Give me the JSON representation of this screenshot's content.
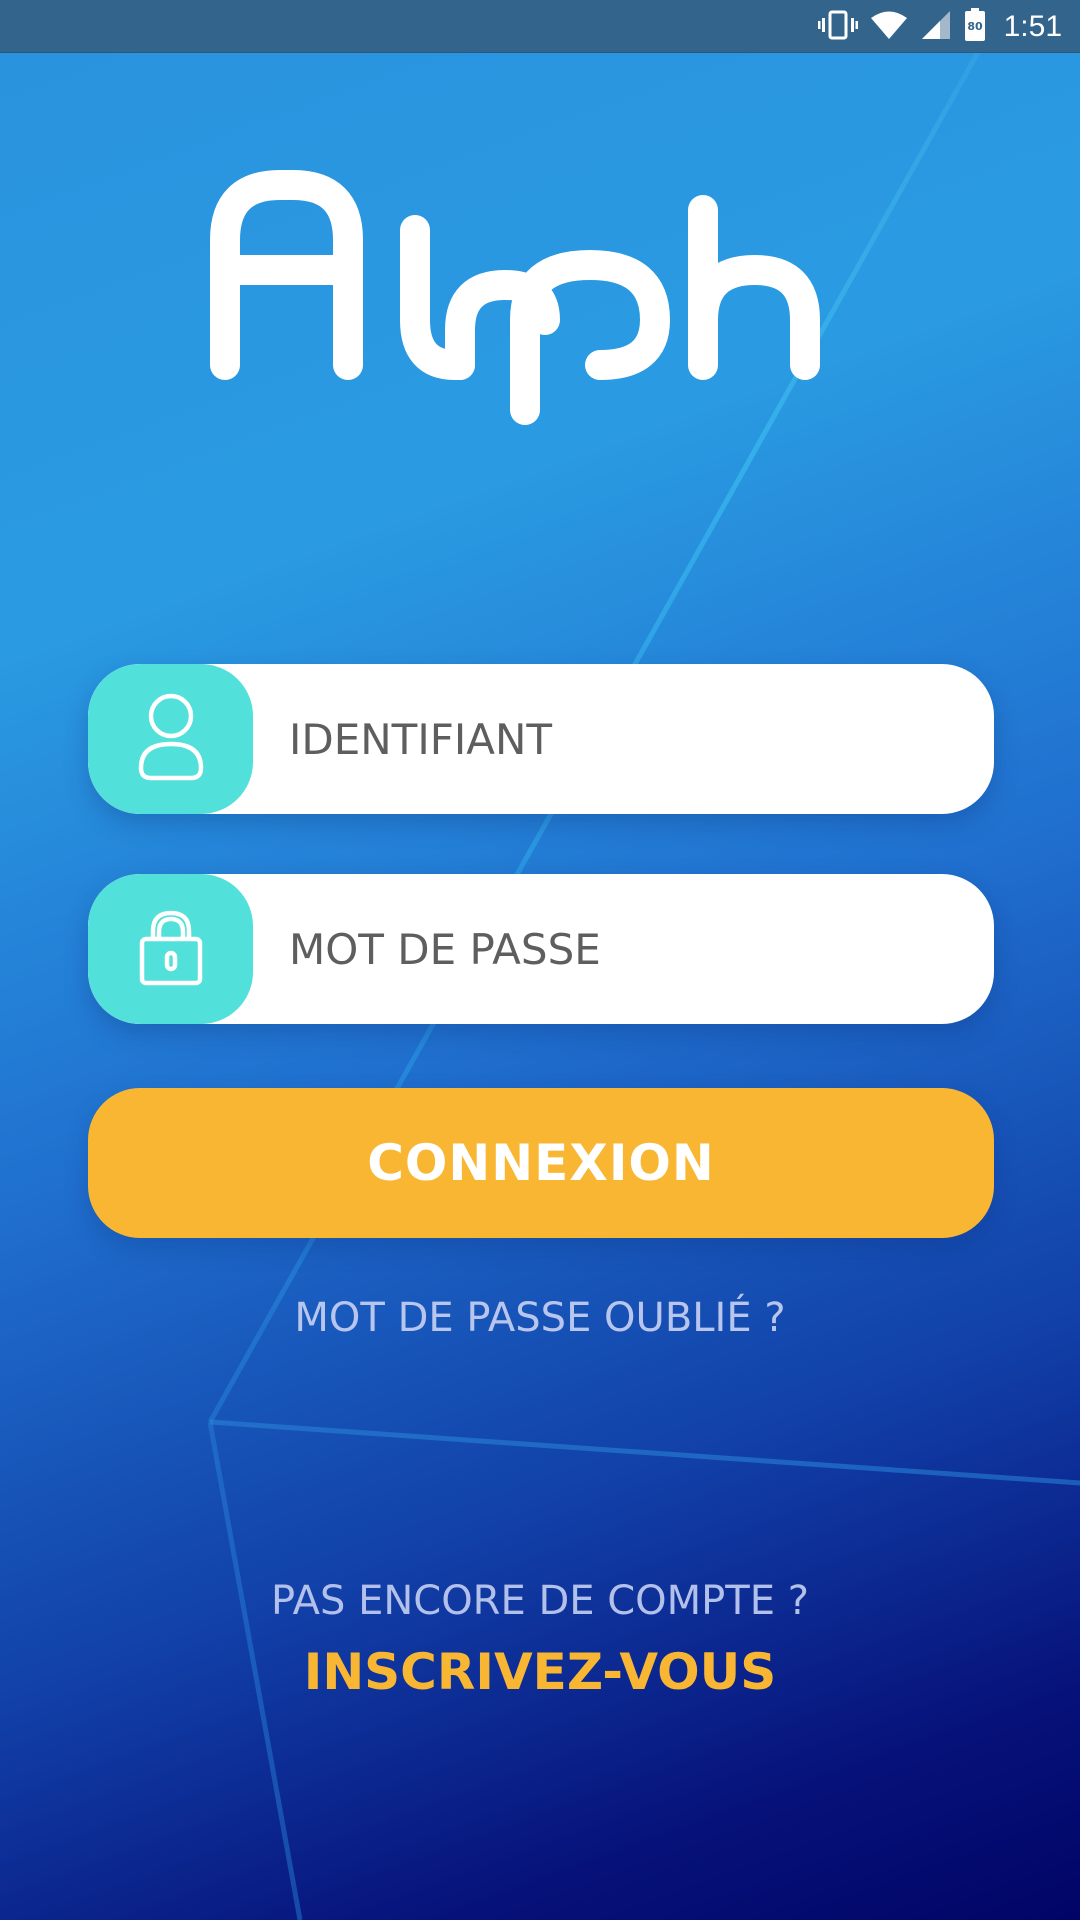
{
  "status_bar": {
    "time": "1:51",
    "battery_level": "80",
    "icons": [
      "vibrate-icon",
      "wifi-icon",
      "cell-signal-icon",
      "battery-icon"
    ]
  },
  "brand": {
    "logo_text": "Alpha"
  },
  "login_form": {
    "username": {
      "placeholder": "IDENTIFIANT",
      "value": "",
      "icon": "user-icon"
    },
    "password": {
      "placeholder": "MOT DE PASSE",
      "value": "",
      "icon": "lock-icon"
    },
    "submit_label": "CONNEXION",
    "forgot_password_label": "MOT DE PASSE OUBLIÉ ?"
  },
  "signup": {
    "prompt": "PAS ENCORE DE COMPTE ?",
    "link_label": "INSCRIVEZ-VOUS"
  },
  "colors": {
    "accent_teal": "#52e0db",
    "accent_yellow": "#f8b633",
    "status_bar": "#33658c",
    "gradient_top": "#2a92de",
    "gradient_bottom": "#010466"
  }
}
